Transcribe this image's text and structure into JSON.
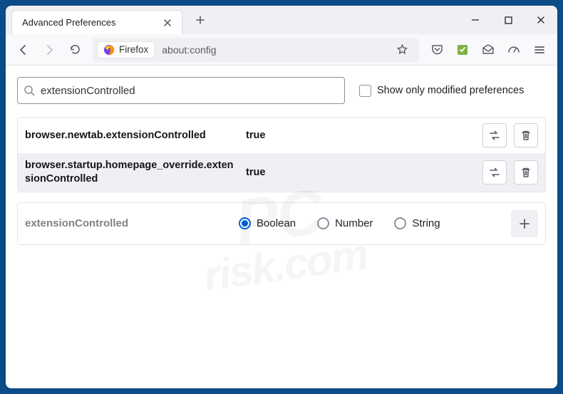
{
  "window": {
    "tab_title": "Advanced Preferences"
  },
  "urlbar": {
    "identity_label": "Firefox",
    "address": "about:config"
  },
  "search": {
    "value": "extensionControlled",
    "placeholder": "",
    "modified_only_label": "Show only modified preferences"
  },
  "prefs": [
    {
      "name": "browser.newtab.extensionControlled",
      "value": "true"
    },
    {
      "name": "browser.startup.homepage_override.extensionControlled",
      "value": "true"
    }
  ],
  "add": {
    "name": "extensionControlled",
    "types": {
      "boolean": "Boolean",
      "number": "Number",
      "string": "String"
    },
    "selected": "boolean"
  },
  "watermark": {
    "line1": "PC",
    "line2": "risk.com"
  }
}
